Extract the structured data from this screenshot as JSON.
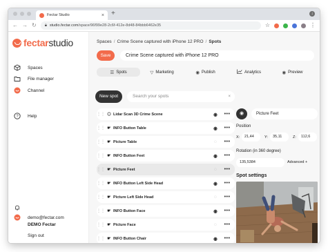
{
  "browser": {
    "tab_title": "Fectar Studio",
    "url_host": "studio.fectar.com",
    "url_path": "/space/96f99e28-2c6f-412e-8d48-84bbb6462e35"
  },
  "sidebar": {
    "logo_left": "fectar",
    "logo_right": "studio",
    "items": [
      {
        "label": "Spaces",
        "icon": "cube-icon"
      },
      {
        "label": "File manager",
        "icon": "folder-icon"
      },
      {
        "label": "Channel",
        "icon": "channel-icon"
      },
      {
        "label": "Help",
        "icon": "help-icon"
      }
    ],
    "email": "demo@fectar.com",
    "org": "DEMO Fectar",
    "sign_out": "Sign out"
  },
  "breadcrumb": {
    "root": "Spaces",
    "space": "Crime Scene captured with iPhone 12 PRO",
    "current": "Spots"
  },
  "toolbar": {
    "save_label": "Save",
    "title_value": "Crime Scene captured with iPhone 12 PRO"
  },
  "tabs": [
    {
      "label": "Spots",
      "icon": "list-icon"
    },
    {
      "label": "Marketing",
      "icon": "filter-icon"
    },
    {
      "label": "Publish",
      "icon": "eye-icon"
    },
    {
      "label": "Analytics",
      "icon": "chart-icon"
    },
    {
      "label": "Preview",
      "icon": "eye-icon"
    }
  ],
  "spots": {
    "new_label": "New spot",
    "search_placeholder": "Search your spots",
    "clear": "×",
    "items": [
      {
        "label": "Lidar Scan 3D Crime Scene",
        "icon": "cube-icon",
        "visible": true
      },
      {
        "label": "INFO Button Table",
        "icon": "hand-pointer-icon",
        "visible": true
      },
      {
        "label": "Picture Table",
        "icon": "hand-pointer-icon",
        "visible": false
      },
      {
        "label": "INFO Button Feet",
        "icon": "hand-pointer-icon",
        "visible": true
      },
      {
        "label": "Picture Feet",
        "icon": "hand-pointer-icon",
        "visible": false
      },
      {
        "label": "INFO Button Left Side Head",
        "icon": "hand-pointer-icon",
        "visible": true
      },
      {
        "label": "Picture Left Side Head",
        "icon": "hand-pointer-icon",
        "visible": false
      },
      {
        "label": "INFO Button Face",
        "icon": "hand-pointer-icon",
        "visible": true
      },
      {
        "label": "Picture Face",
        "icon": "hand-pointer-icon",
        "visible": false
      },
      {
        "label": "INFO Button Chair",
        "icon": "hand-pointer-icon",
        "visible": true
      }
    ],
    "selected_index": 4
  },
  "detail": {
    "name_value": "Picture Feet",
    "position_label": "Position",
    "x_label": "X:",
    "x_value": "21,44",
    "y_label": "Y:",
    "y_value": "35,11",
    "z_label": "Z:",
    "z_value": "112,6",
    "rotation_label": "Rotation (in 360 degree)",
    "rotation_value": "135,5384",
    "advanced_label": "Advanced +",
    "settings_heading": "Spot settings"
  },
  "colors": {
    "accent": "#f26b4b",
    "dark": "#333333"
  }
}
